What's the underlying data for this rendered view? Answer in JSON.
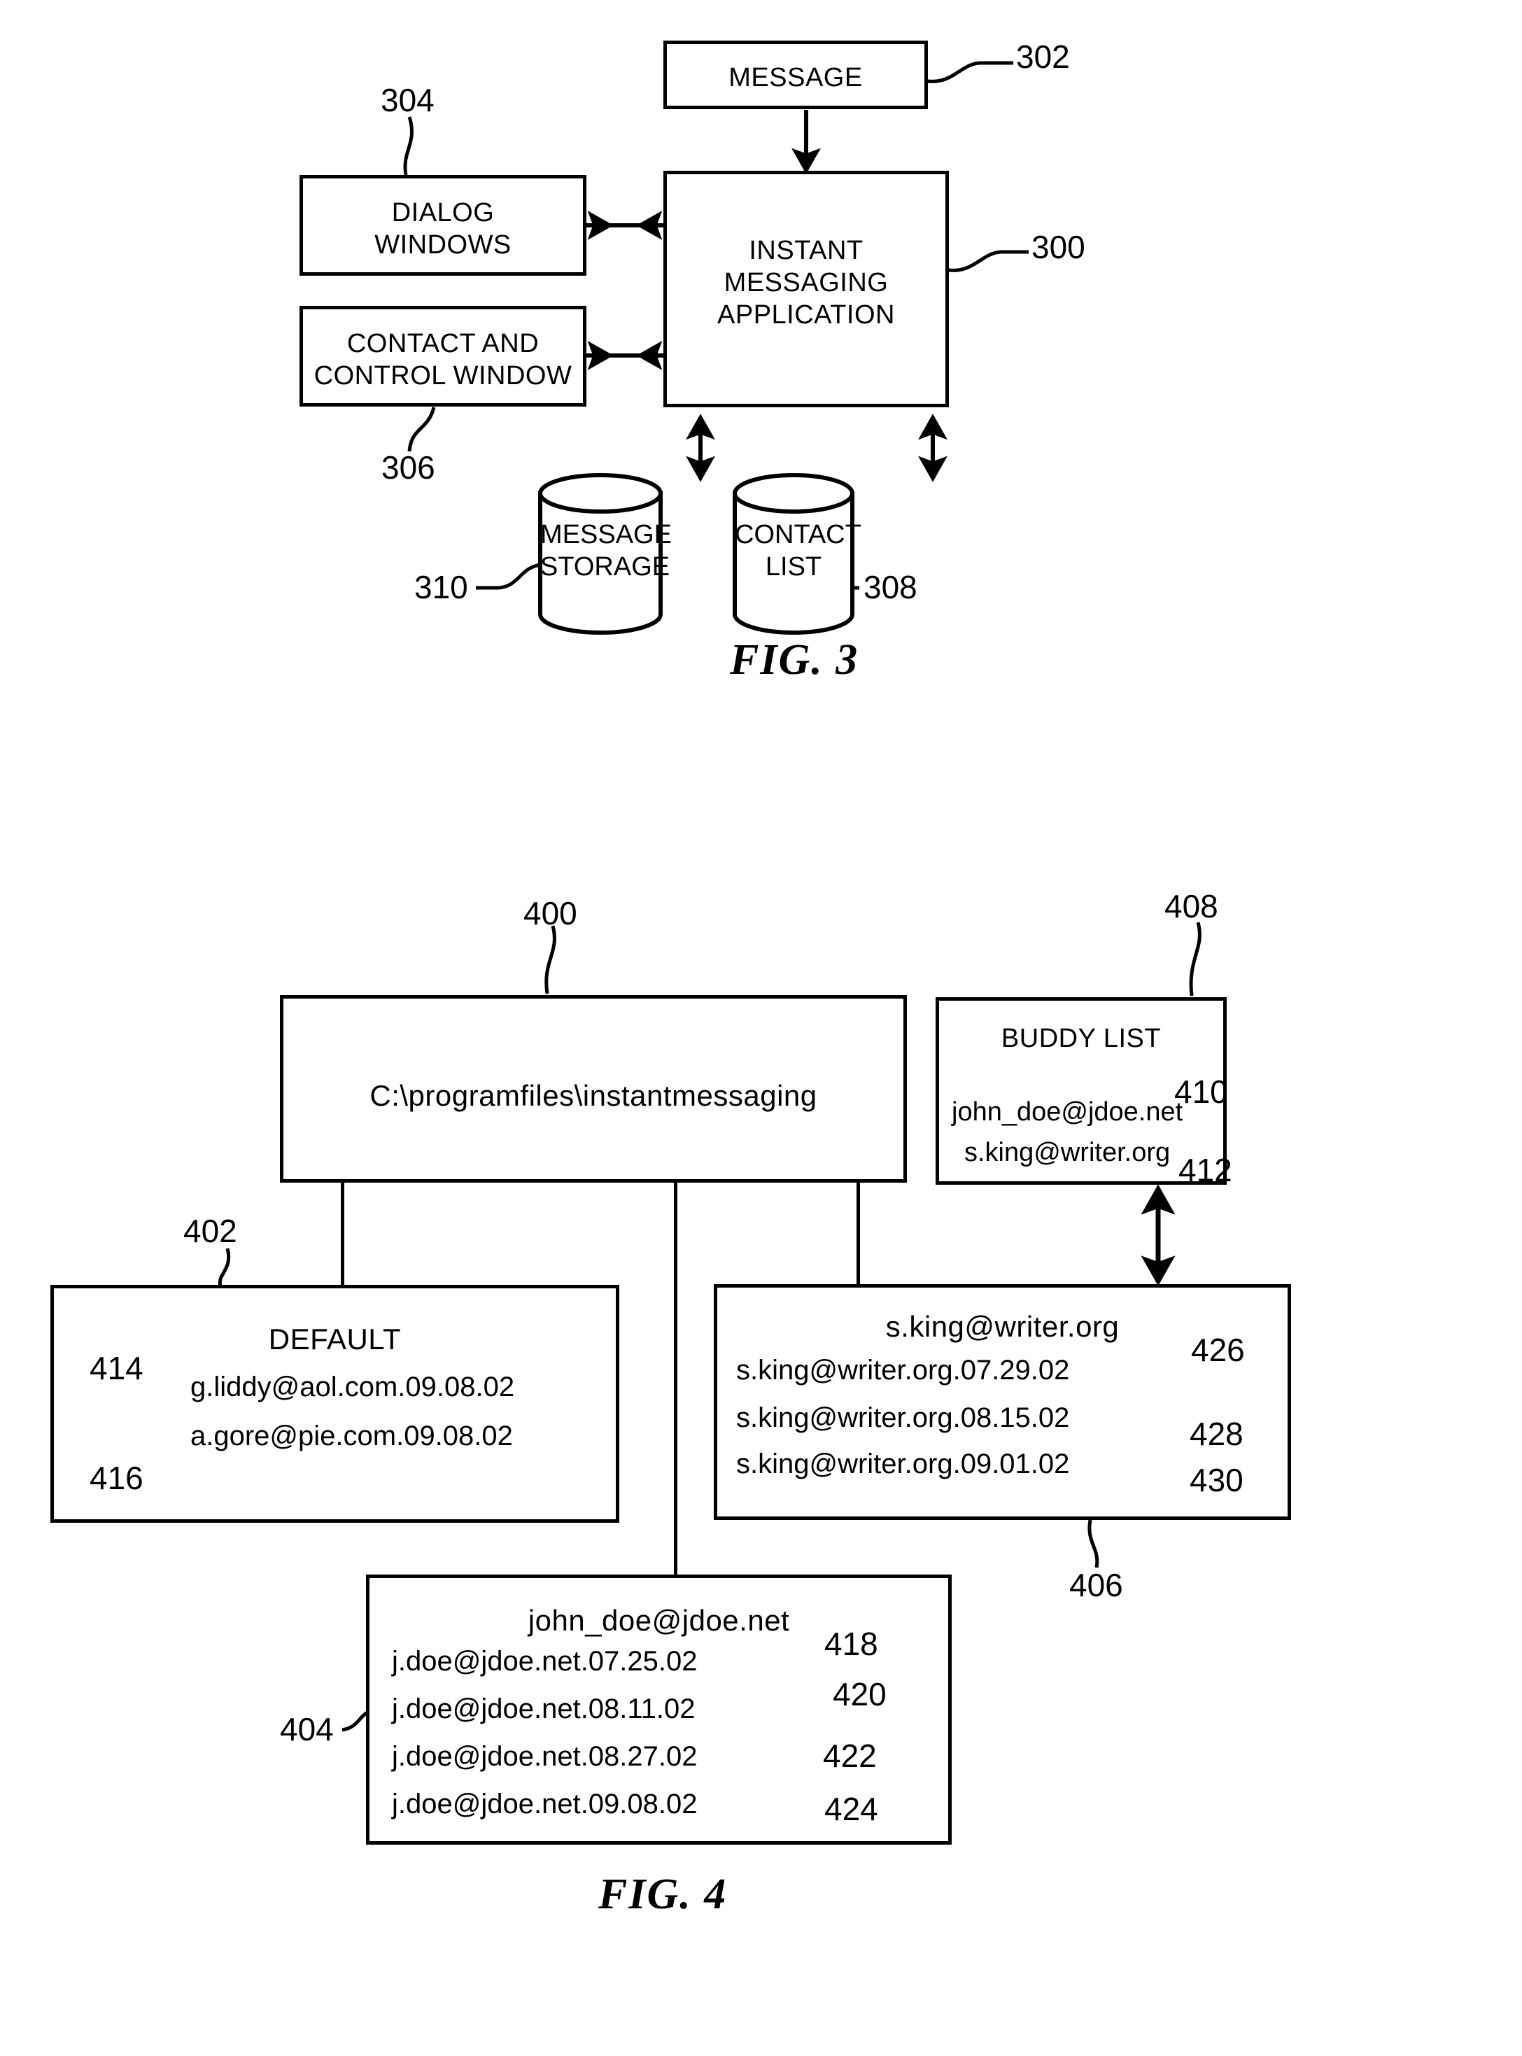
{
  "figure3": {
    "caption": "FIG. 3",
    "blocks": {
      "message": {
        "label": "MESSAGE",
        "ref": "302"
      },
      "dialog_windows": {
        "label_line1": "DIALOG",
        "label_line2": "WINDOWS",
        "ref": "304"
      },
      "contact_control_window": {
        "label_line1": "CONTACT AND",
        "label_line2": "CONTROL WINDOW",
        "ref": "306"
      },
      "instant_messaging_application": {
        "label_line1": "INSTANT",
        "label_line2": "MESSAGING",
        "label_line3": "APPLICATION",
        "ref": "300"
      },
      "message_storage": {
        "label_line1": "MESSAGE",
        "label_line2": "STORAGE",
        "ref": "310"
      },
      "contact_list": {
        "label_line1": "CONTACT",
        "label_line2": "LIST",
        "ref": "308"
      }
    }
  },
  "figure4": {
    "caption": "FIG. 4",
    "root_directory": {
      "path": "C:\\programfiles\\instantmessaging",
      "ref": "400"
    },
    "buddy_list": {
      "title": "BUDDY LIST",
      "ref": "408",
      "entries": [
        {
          "value": "john_doe@jdoe.net",
          "ref": "410"
        },
        {
          "value": "s.king@writer.org",
          "ref": "412"
        }
      ]
    },
    "default_folder": {
      "title": "DEFAULT",
      "ref": "402",
      "entries": [
        {
          "value": "g.liddy@aol.com.09.08.02",
          "ref": "414"
        },
        {
          "value": "a.gore@pie.com.09.08.02",
          "ref": "416"
        }
      ]
    },
    "sking_folder": {
      "title": "s.king@writer.org",
      "ref": "406",
      "entries": [
        {
          "value": "s.king@writer.org.07.29.02",
          "ref": "426"
        },
        {
          "value": "s.king@writer.org.08.15.02",
          "ref": "428"
        },
        {
          "value": "s.king@writer.org.09.01.02",
          "ref": "430"
        }
      ]
    },
    "jdoe_folder": {
      "title": "john_doe@jdoe.net",
      "ref": "404",
      "entries": [
        {
          "value": "j.doe@jdoe.net.07.25.02",
          "ref": "418"
        },
        {
          "value": "j.doe@jdoe.net.08.11.02",
          "ref": "420"
        },
        {
          "value": "j.doe@jdoe.net.08.27.02",
          "ref": "422"
        },
        {
          "value": "j.doe@jdoe.net.09.08.02",
          "ref": "424"
        }
      ]
    }
  }
}
